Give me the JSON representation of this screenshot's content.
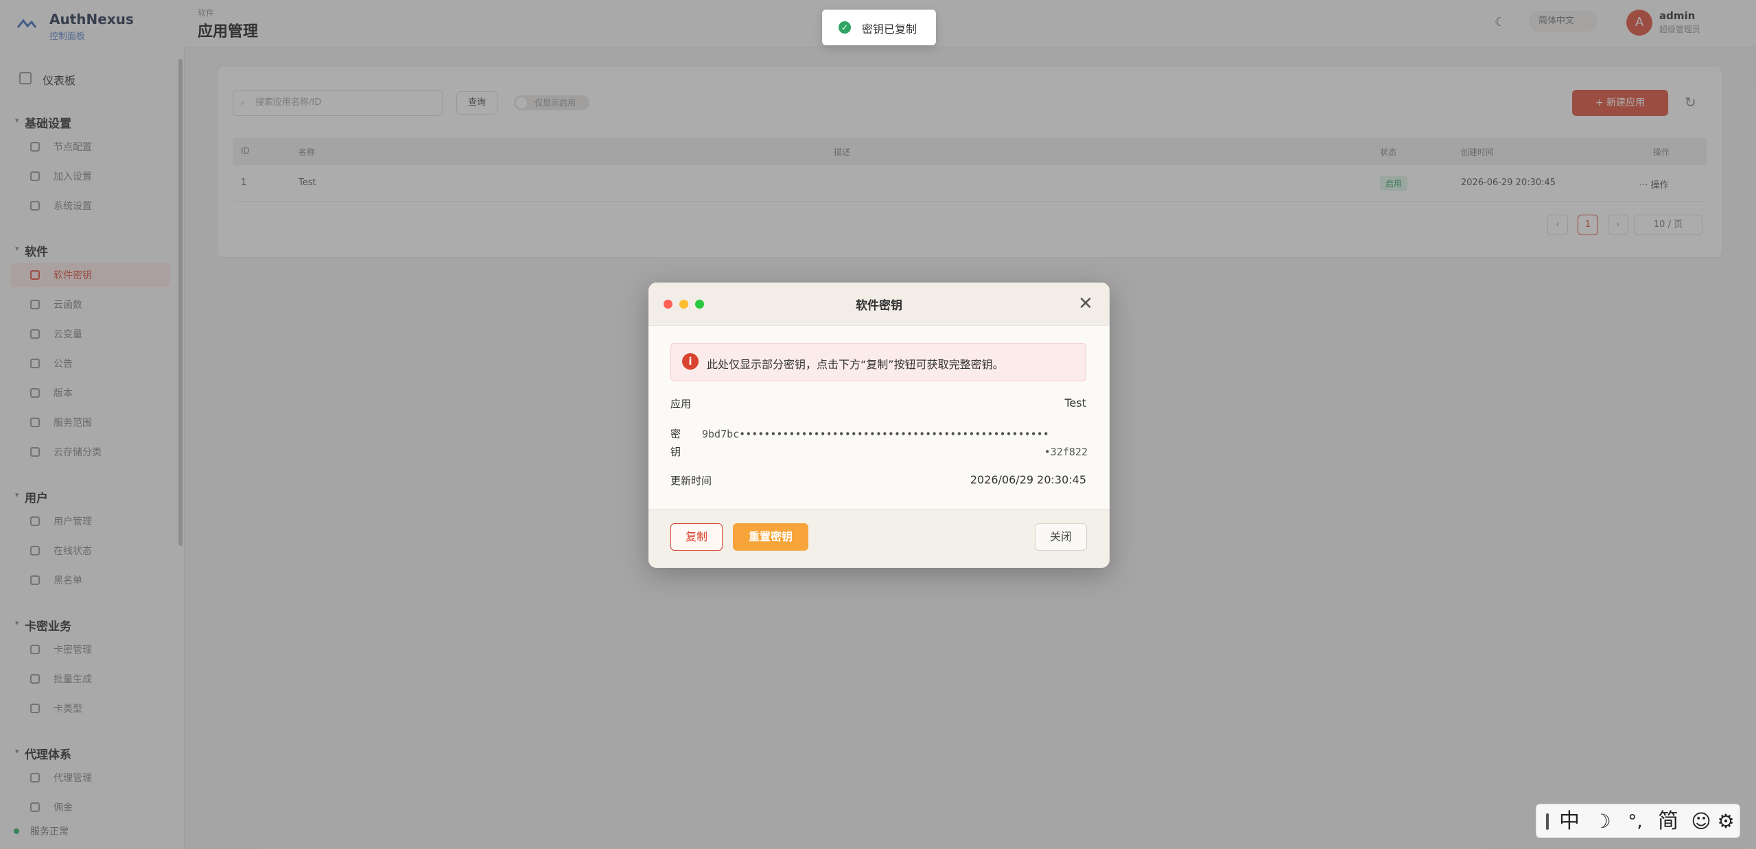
{
  "app": {
    "brand_name": "AuthNexus",
    "brand_sub": "控制面板"
  },
  "sidebar": {
    "top_item": "仪表板",
    "groups": [
      {
        "title": "基础设置",
        "items": [
          "节点配置",
          "加入设置",
          "系统设置"
        ]
      },
      {
        "title": "软件",
        "items": [
          "软件密钥",
          "云函数",
          "云变量",
          "公告",
          "版本",
          "服务范围",
          "云存储分类"
        ]
      },
      {
        "title": "用户",
        "items": [
          "用户管理",
          "在线状态",
          "黑名单"
        ]
      },
      {
        "title": "卡密业务",
        "items": [
          "卡密管理",
          "批量生成",
          "卡类型"
        ]
      },
      {
        "title": "代理体系",
        "items": [
          "代理管理",
          "佣金"
        ]
      }
    ],
    "active_item": "软件密钥",
    "footer": "服务正常"
  },
  "header": {
    "breadcrumb": "软件",
    "title": "应用管理",
    "lang": "简体中文",
    "avatar_letter": "A",
    "user_name": "admin",
    "user_role": "超级管理员"
  },
  "list": {
    "search_placeholder": "搜索应用名称/ID",
    "search_button": "查询",
    "toggle_label": "仅显示启用",
    "create_button": "+ 新建应用",
    "columns": [
      "ID",
      "名称",
      "描述",
      "状态",
      "创建时间",
      "操作"
    ],
    "rows": [
      {
        "id": "1",
        "name": "Test",
        "desc": "",
        "status": "启用",
        "created": "2026-06-29 20:30:45",
        "action": "··· 操作"
      }
    ],
    "pages": [
      "‹",
      "1",
      "›"
    ],
    "page_size": "10 / 页"
  },
  "toast": {
    "message": "密钥已复制",
    "icon": "check-circle-icon",
    "color": "#2fa463"
  },
  "dialog": {
    "title": "软件密钥",
    "alert": "此处仅显示部分密钥，点击下方“复制”按钮可获取完整密钥。",
    "app_label": "应用",
    "app_value": "Test",
    "key_label": "密钥",
    "key_line1": "9bd7bc••••••••••••••••••••••••••••••••••••••••••••••••••",
    "key_line2": "•32f822",
    "updated_label": "更新时间",
    "updated_value": "2026/06/29 20:30:45",
    "copy_button": "复制",
    "reset_button": "重置密钥",
    "close_button": "关闭"
  },
  "ime": {
    "items": [
      "中",
      "☽",
      "°,",
      "简",
      "☺",
      "⚙"
    ]
  },
  "colors": {
    "accent": "#e0523d",
    "warning": "#f7a43a",
    "success": "#2fa463"
  }
}
